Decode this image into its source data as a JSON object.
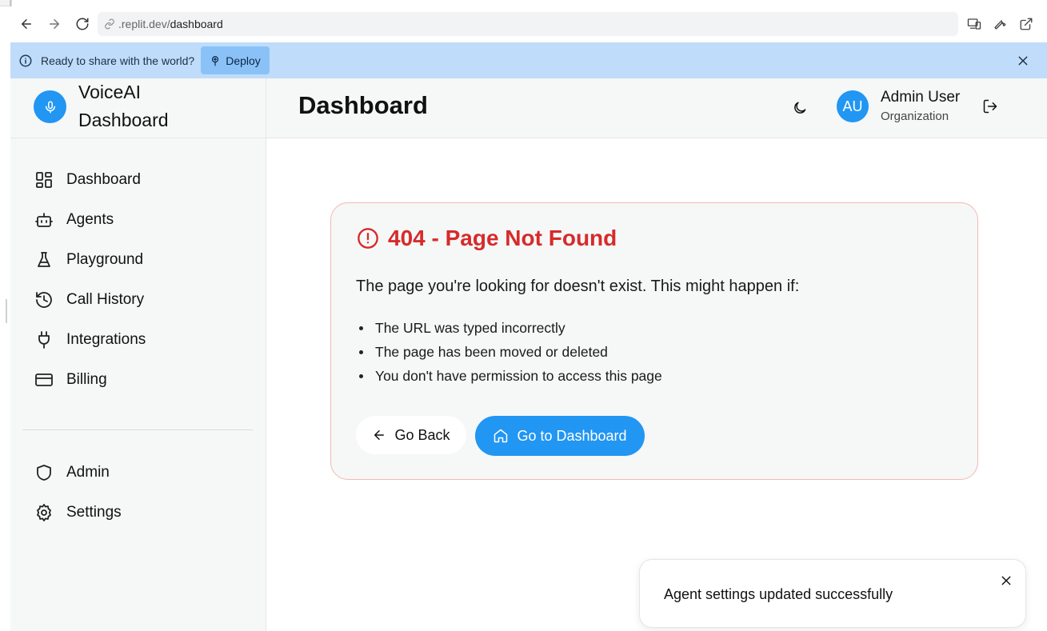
{
  "browser": {
    "url_host": ".replit.dev/",
    "url_path": "dashboard"
  },
  "banner": {
    "message": "Ready to share with the world?",
    "deploy_label": "Deploy",
    "color": "#bfdcfa"
  },
  "sidebar": {
    "brand_line1": "VoiceAI",
    "brand_line2": "Dashboard",
    "items": [
      {
        "label": "Dashboard",
        "icon": "layout-grid-icon"
      },
      {
        "label": "Agents",
        "icon": "bot-icon"
      },
      {
        "label": "Playground",
        "icon": "flask-icon"
      },
      {
        "label": "Call History",
        "icon": "history-icon"
      },
      {
        "label": "Integrations",
        "icon": "plug-icon"
      },
      {
        "label": "Billing",
        "icon": "credit-card-icon"
      }
    ],
    "bottom_items": [
      {
        "label": "Admin",
        "icon": "shield-icon"
      },
      {
        "label": "Settings",
        "icon": "gear-icon"
      }
    ]
  },
  "header": {
    "title": "Dashboard",
    "user_initials": "AU",
    "user_name": "Admin User",
    "user_org": "Organization"
  },
  "error": {
    "title": "404 - Page Not Found",
    "description": "The page you're looking for doesn't exist. This might happen if:",
    "reasons": [
      "The URL was typed incorrectly",
      "The page has been moved or deleted",
      "You don't have permission to access this page"
    ],
    "back_label": "Go Back",
    "dashboard_label": "Go to Dashboard",
    "accent": "#d62b2b"
  },
  "toast": {
    "message": "Agent settings updated successfully"
  },
  "colors": {
    "primary": "#2196f3"
  }
}
